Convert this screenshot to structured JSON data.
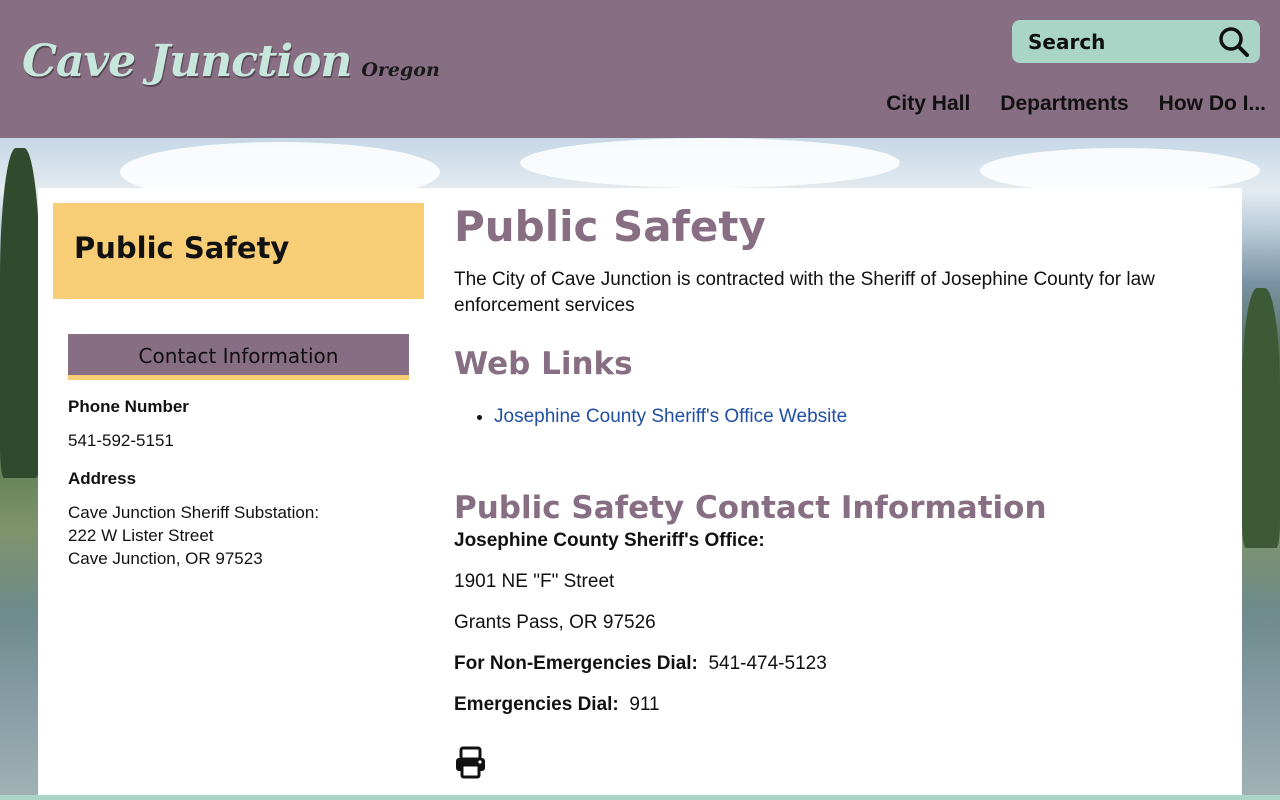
{
  "header": {
    "logo_main": "Cave Junction",
    "logo_sub": "Oregon",
    "search_placeholder": "Search",
    "nav": [
      "City Hall",
      "Departments",
      "How Do I..."
    ]
  },
  "sidebar": {
    "title": "Public Safety",
    "contact_heading": "Contact Information",
    "phone_label": "Phone Number",
    "phone": "541-592-5151",
    "address_label": "Address",
    "address_lines": [
      "Cave Junction Sheriff Substation:",
      "222 W Lister Street",
      "Cave Junction, OR 97523"
    ]
  },
  "main": {
    "title": "Public Safety",
    "intro": "The City of Cave Junction is contracted with the Sheriff of Josephine County for law enforcement services",
    "web_links_heading": "Web Links",
    "links": [
      "Josephine County Sheriff's Office Website"
    ],
    "contact_heading": "Public Safety Contact Information",
    "office_name": "Josephine County Sheriff's Office:",
    "street": "1901 NE \"F\" Street",
    "city": "Grants Pass, OR 97526",
    "non_emergency_label": "For Non-Emergencies Dial:",
    "non_emergency_number": "541-474-5123",
    "emergency_label": "Emergencies Dial:",
    "emergency_number": "911"
  },
  "colors": {
    "header_bg": "#876e82",
    "accent_mint": "#a9d4c6",
    "accent_yellow": "#f7cd76",
    "heading": "#876e82",
    "link": "#1f4fa3"
  },
  "icons": [
    "search-icon",
    "print-icon"
  ]
}
